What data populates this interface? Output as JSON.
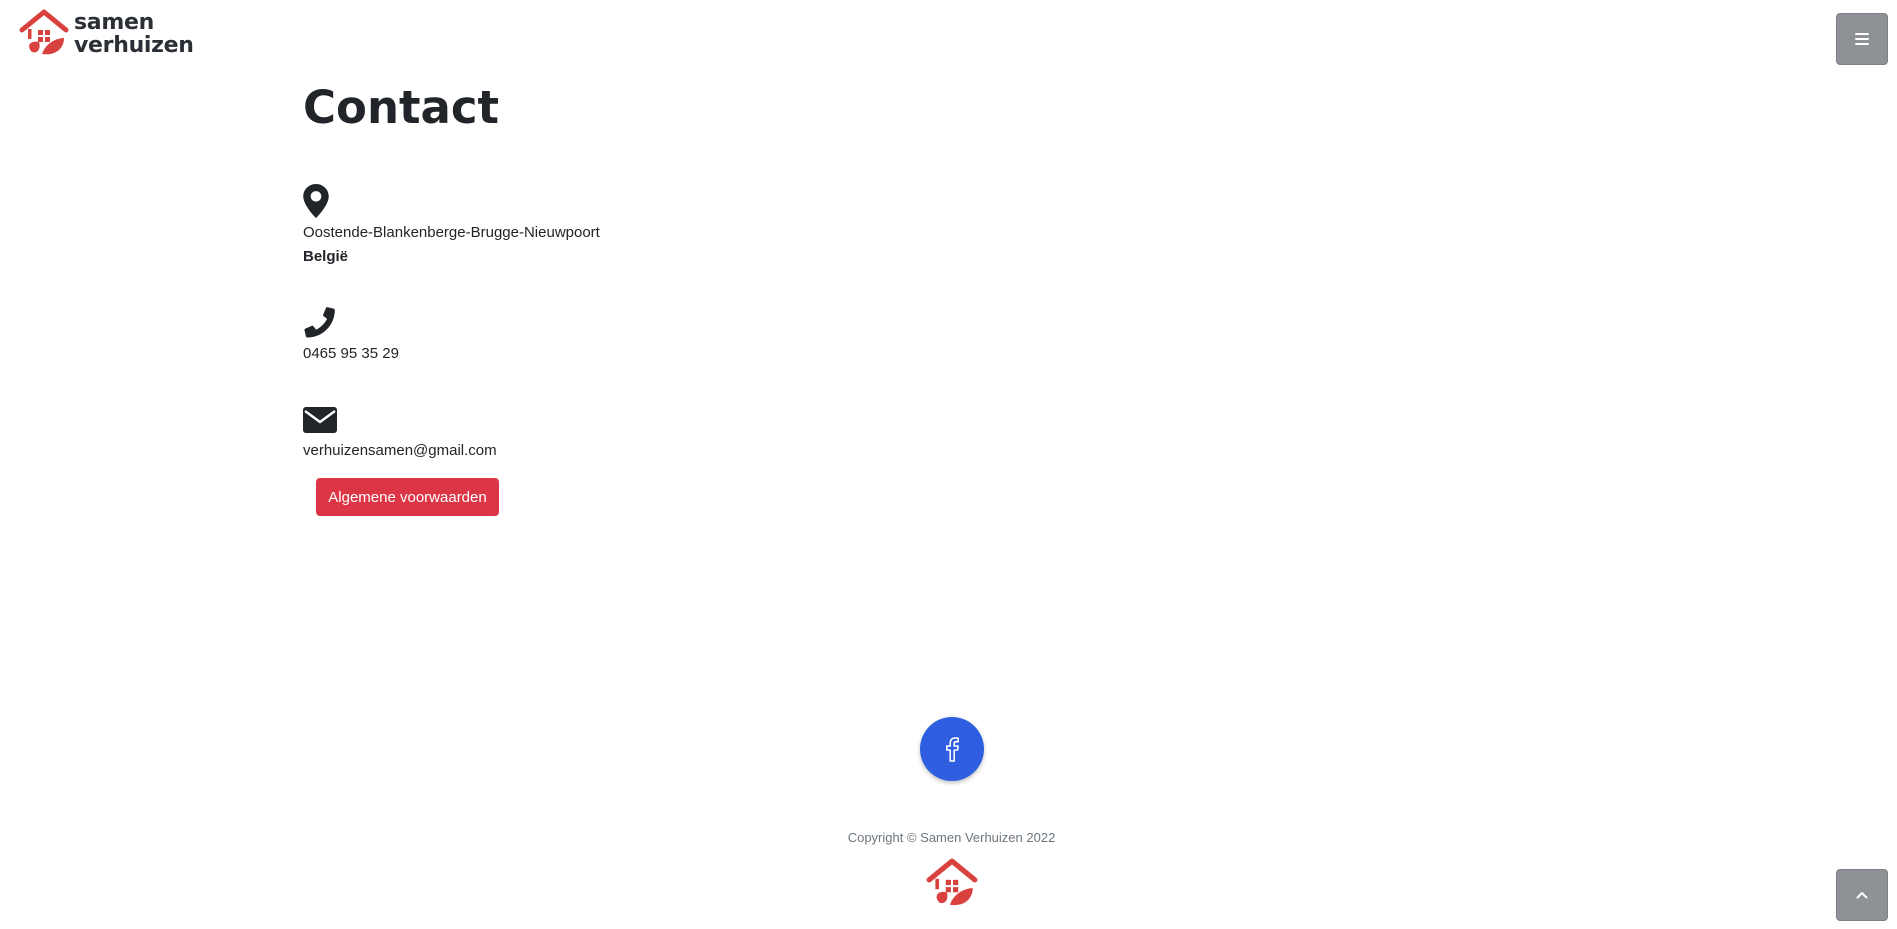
{
  "brand": {
    "line1": "samen",
    "line2": "verhuizen",
    "accent_color": "#d9413f"
  },
  "header": {
    "menu_icon": "hamburger-icon"
  },
  "main": {
    "title": "Contact",
    "address": {
      "icon": "map-marker-icon",
      "line1": "Oostende-Blankenberge-Brugge-Nieuwpoort",
      "line2": "België"
    },
    "phone": {
      "icon": "phone-icon",
      "value": "0465 95 35 29"
    },
    "email": {
      "icon": "envelope-icon",
      "value": "verhuizensamen@gmail.com"
    },
    "terms_button": {
      "label": "Algemene voorwaarden",
      "color": "#dc3545"
    }
  },
  "footer": {
    "social_icon": "facebook-icon",
    "social_color": "#2f5fe0",
    "copyright": "Copyright © Samen Verhuizen 2022",
    "back_to_top_icon": "chevron-up-icon"
  }
}
